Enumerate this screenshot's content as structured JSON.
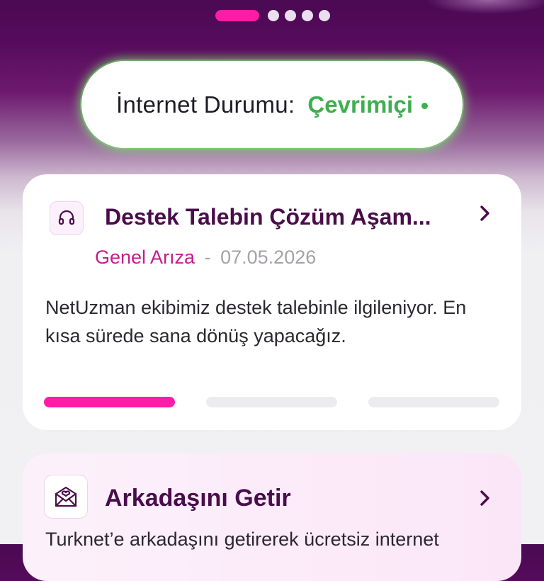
{
  "carousel": {
    "count": 5,
    "active_index": 0
  },
  "status": {
    "label": "İnternet Durumu:",
    "value": "Çevrimiçi",
    "value_color": "#3fae4f"
  },
  "ticket": {
    "icon": "headset-icon",
    "title": "Destek Talebin Çözüm Aşam...",
    "category": "Genel Arıza",
    "separator": "-",
    "date": "07.05.2026",
    "description": "NetUzman ekibimiz destek talebinle ilgileniyor. En kısa sürede sana dönüş yapacağız.",
    "progress": {
      "steps_total": 3,
      "steps_done": 1
    },
    "accent_color": "#ff1ca6"
  },
  "referral": {
    "icon": "envelope-heart-icon",
    "title": "Arkadaşını Getir",
    "description": "Turknet’e arkadaşını getirerek ücretsiz internet"
  }
}
